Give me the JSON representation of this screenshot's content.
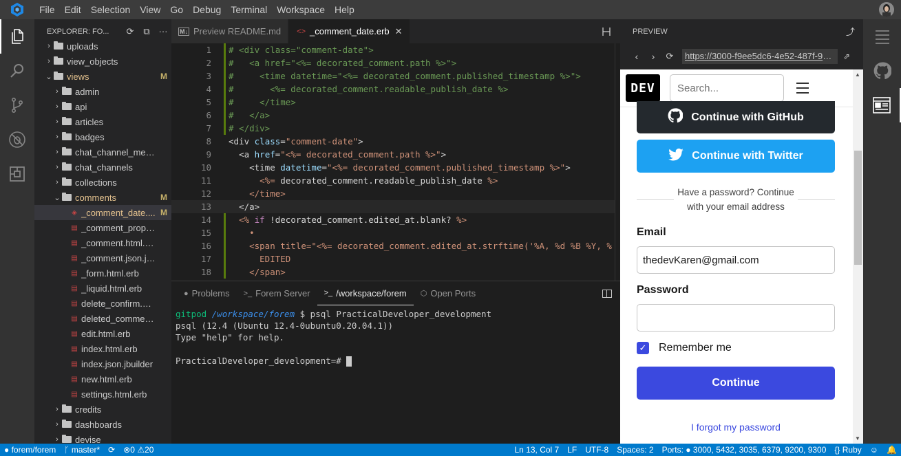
{
  "menubar": {
    "items": [
      "File",
      "Edit",
      "Selection",
      "View",
      "Go",
      "Debug",
      "Terminal",
      "Workspace",
      "Help"
    ]
  },
  "activitybar": {
    "icons": [
      "files-icon",
      "search-icon",
      "source-control-icon",
      "debug-icon",
      "extensions-icon"
    ]
  },
  "sidebar": {
    "title": "EXPLORER: FO...",
    "tree": [
      {
        "label": "uploads",
        "type": "folder",
        "depth": 1,
        "open": false,
        "mod": ""
      },
      {
        "label": "view_objects",
        "type": "folder",
        "depth": 1,
        "open": false,
        "mod": ""
      },
      {
        "label": "views",
        "type": "folder",
        "depth": 1,
        "open": true,
        "mod": "M"
      },
      {
        "label": "admin",
        "type": "folder",
        "depth": 2,
        "open": false,
        "mod": ""
      },
      {
        "label": "api",
        "type": "folder",
        "depth": 2,
        "open": false,
        "mod": ""
      },
      {
        "label": "articles",
        "type": "folder",
        "depth": 2,
        "open": false,
        "mod": ""
      },
      {
        "label": "badges",
        "type": "folder",
        "depth": 2,
        "open": false,
        "mod": ""
      },
      {
        "label": "chat_channel_memb...",
        "type": "folder",
        "depth": 2,
        "open": false,
        "mod": ""
      },
      {
        "label": "chat_channels",
        "type": "folder",
        "depth": 2,
        "open": false,
        "mod": ""
      },
      {
        "label": "collections",
        "type": "folder",
        "depth": 2,
        "open": false,
        "mod": ""
      },
      {
        "label": "comments",
        "type": "folder",
        "depth": 2,
        "open": true,
        "mod": "M"
      },
      {
        "label": "_comment_date....",
        "type": "file",
        "depth": 3,
        "mod": "M",
        "selected": true
      },
      {
        "label": "_comment_proper.h...",
        "type": "file",
        "depth": 3,
        "mod": ""
      },
      {
        "label": "_comment.html.erb",
        "type": "file",
        "depth": 3,
        "mod": ""
      },
      {
        "label": "_comment.json.jbuil...",
        "type": "file",
        "depth": 3,
        "mod": ""
      },
      {
        "label": "_form.html.erb",
        "type": "file",
        "depth": 3,
        "mod": ""
      },
      {
        "label": "_liquid.html.erb",
        "type": "file",
        "depth": 3,
        "mod": ""
      },
      {
        "label": "delete_confirm.html....",
        "type": "file",
        "depth": 3,
        "mod": ""
      },
      {
        "label": "deleted_commentab...",
        "type": "file",
        "depth": 3,
        "mod": ""
      },
      {
        "label": "edit.html.erb",
        "type": "file",
        "depth": 3,
        "mod": ""
      },
      {
        "label": "index.html.erb",
        "type": "file",
        "depth": 3,
        "mod": ""
      },
      {
        "label": "index.json.jbuilder",
        "type": "file",
        "depth": 3,
        "mod": ""
      },
      {
        "label": "new.html.erb",
        "type": "file",
        "depth": 3,
        "mod": ""
      },
      {
        "label": "settings.html.erb",
        "type": "file",
        "depth": 3,
        "mod": ""
      },
      {
        "label": "credits",
        "type": "folder",
        "depth": 2,
        "open": false,
        "mod": ""
      },
      {
        "label": "dashboards",
        "type": "folder",
        "depth": 2,
        "open": false,
        "mod": ""
      },
      {
        "label": "devise",
        "type": "folder",
        "depth": 2,
        "open": false,
        "mod": ""
      }
    ]
  },
  "editor": {
    "tabs": [
      {
        "label": "Preview README.md",
        "active": false
      },
      {
        "label": "_comment_date.erb",
        "active": true
      }
    ],
    "lines": [
      {
        "n": "1",
        "mod": true,
        "html": "<span class=\"cm\"># &lt;div class=\"comment-date\"&gt;</span>"
      },
      {
        "n": "2",
        "mod": true,
        "html": "<span class=\"cm\">#   &lt;a href=\"&lt;%= decorated_comment.path %&gt;\"&gt;</span>"
      },
      {
        "n": "3",
        "mod": true,
        "html": "<span class=\"cm\">#     &lt;time datetime=\"&lt;%= decorated_comment.published_timestamp %&gt;\"&gt;</span>"
      },
      {
        "n": "4",
        "mod": true,
        "html": "<span class=\"cm\">#       &lt;%= decorated_comment.readable_publish_date %&gt;</span>"
      },
      {
        "n": "5",
        "mod": true,
        "html": "<span class=\"cm\">#     &lt;/time&gt;</span>"
      },
      {
        "n": "6",
        "mod": true,
        "html": "<span class=\"cm\">#   &lt;/a&gt;</span>"
      },
      {
        "n": "7",
        "mod": true,
        "html": "<span class=\"cm\"># &lt;/div&gt;</span>"
      },
      {
        "n": "8",
        "mod": false,
        "html": "<span class=\"tg\">&lt;div </span><span class=\"at\">class</span><span class=\"tg\">=</span><span class=\"st\">\"comment-date\"</span><span class=\"tg\">&gt;</span>"
      },
      {
        "n": "9",
        "mod": false,
        "html": "<span class=\"tg\">  &lt;a </span><span class=\"at\">href</span><span class=\"tg\">=</span><span class=\"st\">\"&lt;%= decorated_comment.path %&gt;\"</span><span class=\"tg\">&gt;</span>"
      },
      {
        "n": "10",
        "mod": false,
        "html": "<span class=\"tg\">    &lt;time </span><span class=\"at\">datetime</span><span class=\"tg\">=</span><span class=\"st\">\"&lt;%= decorated_comment.published_timestamp %&gt;\"</span><span class=\"tg\">&gt;</span>"
      },
      {
        "n": "11",
        "mod": false,
        "html": "<span class=\"tg\">      </span><span class=\"erb\">&lt;%=</span><span class=\"tg\"> decorated_comment.readable_publish_date </span><span class=\"erb\">%&gt;</span>"
      },
      {
        "n": "12",
        "mod": false,
        "html": "<span class=\"erb\">    &lt;/time&gt;</span>"
      },
      {
        "n": "13",
        "mod": false,
        "html": "<span class=\"tg\">  &lt;/a&gt;</span>",
        "current": true
      },
      {
        "n": "14",
        "mod": true,
        "html": "<span class=\"tg\">  </span><span class=\"erb\">&lt;%</span><span class=\"kw\"> if</span><span class=\"tg\"> !decorated_comment.edited_at.blank? </span><span class=\"erb\">%&gt;</span>"
      },
      {
        "n": "15",
        "mod": true,
        "html": "<span class=\"erb\">    •</span>"
      },
      {
        "n": "16",
        "mod": true,
        "html": "<span class=\"erb\">    &lt;span title=\"&lt;%= decorated_comment.edited_at.strftime('%A, %d %B %Y, %</span>"
      },
      {
        "n": "17",
        "mod": true,
        "html": "<span class=\"erb\">      EDITED</span>"
      },
      {
        "n": "18",
        "mod": true,
        "html": "<span class=\"erb\">    &lt;/span&gt;</span>"
      }
    ]
  },
  "panel": {
    "tabs": [
      {
        "label": "Problems",
        "icon": "●",
        "active": false
      },
      {
        "label": "Forem Server",
        "icon": ">_",
        "active": false
      },
      {
        "label": "/workspace/forem",
        "icon": ">_",
        "active": true
      },
      {
        "label": "Open Ports",
        "icon": "⬡",
        "active": false
      }
    ],
    "terminal": {
      "user": "gitpod",
      "path": "/workspace/forem",
      "cmd": " $ psql PracticalDeveloper_development",
      "line2": "psql (12.4 (Ubuntu 12.4-0ubuntu0.20.04.1))",
      "line3": "Type \"help\" for help.",
      "prompt": "PracticalDeveloper_development=# "
    }
  },
  "preview": {
    "title": "PREVIEW",
    "url": "https://3000-f9ee5dc6-4e52-487f-9b...",
    "page": {
      "logo": "DEV",
      "search_placeholder": "Search...",
      "github_label": "Continue with GitHub",
      "twitter_label": "Continue with Twitter",
      "divider_text": "Have a password? Continue with your email address",
      "email_label": "Email",
      "email_value": "thedevKaren@gmail.com",
      "password_label": "Password",
      "remember_label": "Remember me",
      "continue_label": "Continue",
      "forgot_label": "I forgot my password"
    }
  },
  "statusbar": {
    "repo": "forem/forem",
    "branch": "master*",
    "errors": "0",
    "warnings": "20",
    "position": "Ln 13, Col 7",
    "eol": "LF",
    "encoding": "UTF-8",
    "spaces": "Spaces: 2",
    "ports_label": "Ports:",
    "ports": "3000, 5432, 3035, 6379, 9200, 9300",
    "language": "Ruby"
  },
  "colors": {
    "accent": "#007acc",
    "dev_primary": "#3b49df",
    "twitter": "#1da1f2",
    "github": "#24292e"
  }
}
